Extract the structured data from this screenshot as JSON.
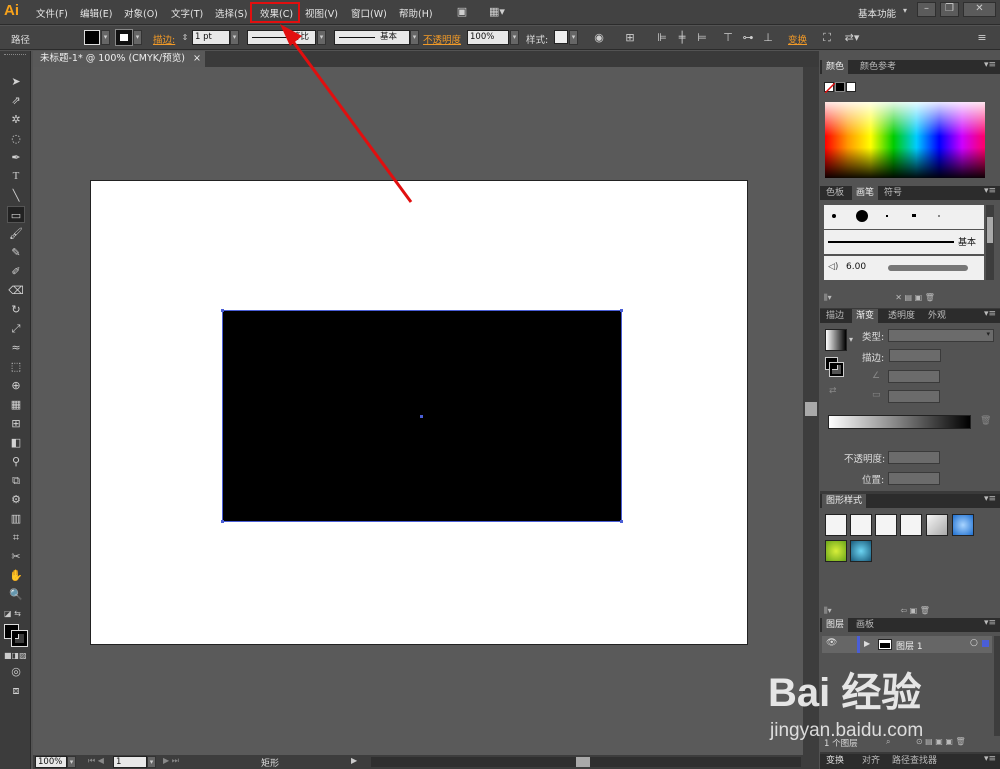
{
  "app": {
    "logo": "Ai",
    "workspace": "基本功能"
  },
  "menu": [
    "文件(F)",
    "编辑(E)",
    "对象(O)",
    "文字(T)",
    "选择(S)",
    "效果(C)",
    "视图(V)",
    "窗口(W)",
    "帮助(H)"
  ],
  "control": {
    "selection_type": "路径",
    "stroke_label": "描边:",
    "stroke_weight": "1 pt",
    "profile_label": "等比",
    "brush_label": "基本",
    "opacity_label": "不透明度",
    "opacity_value": "100%",
    "style_label": "样式:",
    "transform_label": "变换"
  },
  "document": {
    "tab_title": "未标题-1* @ 100% (CMYK/预览)"
  },
  "status": {
    "zoom": "100%",
    "page": "1",
    "tool_name": "矩形"
  },
  "panels": {
    "color_tabs": [
      "颜色",
      "颜色参考"
    ],
    "brush_tabs": [
      "色板",
      "画笔",
      "符号"
    ],
    "brush_basic": "基本",
    "brush_size": "6.00",
    "gradient_tabs": [
      "描边",
      "渐变",
      "透明度",
      "外观"
    ],
    "gradient_type_label": "类型:",
    "gradient_stroke_label": "描边:",
    "gradient_opacity_label": "不透明度:",
    "gradient_location_label": "位置:",
    "graphic_styles_tab": "图形样式",
    "layers_tabs": [
      "图层",
      "画板"
    ],
    "layer_name": "图层 1",
    "layers_count": "1 个图层",
    "bottom_tabs": [
      "变换",
      "对齐",
      "路径查找器"
    ]
  },
  "watermark": {
    "main": "Bai 经验",
    "sub": "jingyan.baidu.com"
  },
  "colors": {
    "accent_orange": "#f29a27",
    "highlight_red": "#e10f0f",
    "selection_blue": "#4a5ed6"
  }
}
